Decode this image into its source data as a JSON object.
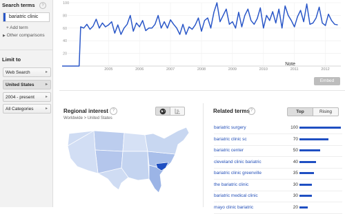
{
  "sidebar": {
    "search_terms_heading": "Search terms",
    "help_icon": "?",
    "term": "bariatric clinic",
    "add_term": "+ Add term",
    "other_comparisons": "Other comparisons",
    "limit_heading": "Limit to",
    "filters": [
      {
        "label": "Web Search",
        "selected": false
      },
      {
        "label": "United States",
        "selected": true
      },
      {
        "label": "2004 - present",
        "selected": false
      },
      {
        "label": "All Categories",
        "selected": false
      }
    ]
  },
  "chart_data": {
    "type": "line",
    "x_ticks": [
      "2005",
      "2006",
      "2007",
      "2008",
      "2009",
      "2010",
      "2011",
      "2012"
    ],
    "y_ticks": [
      "100",
      "80",
      "60",
      "40",
      "20"
    ],
    "ylim": [
      0,
      100
    ],
    "annotation": "Note",
    "color": "#2a57c8",
    "x": [
      2004.0,
      2004.3,
      2004.55,
      2004.6,
      2004.7,
      2004.8,
      2004.9,
      2005.0,
      2005.1,
      2005.2,
      2005.3,
      2005.4,
      2005.5,
      2005.6,
      2005.7,
      2005.8,
      2005.9,
      2006.0,
      2006.1,
      2006.2,
      2006.3,
      2006.4,
      2006.5,
      2006.6,
      2006.7,
      2006.8,
      2006.9,
      2007.0,
      2007.1,
      2007.2,
      2007.3,
      2007.4,
      2007.5,
      2007.6,
      2007.7,
      2007.8,
      2007.9,
      2008.0,
      2008.1,
      2008.2,
      2008.3,
      2008.4,
      2008.5,
      2008.6,
      2008.7,
      2008.8,
      2008.9,
      2009.0,
      2009.1,
      2009.2,
      2009.3,
      2009.4,
      2009.5,
      2009.6,
      2009.7,
      2009.8,
      2009.9,
      2010.0,
      2010.1,
      2010.2,
      2010.3,
      2010.4,
      2010.5,
      2010.6,
      2010.7,
      2010.8,
      2010.9,
      2011.0,
      2011.1,
      2011.2,
      2011.3,
      2011.4,
      2011.5,
      2011.6,
      2011.7,
      2011.8,
      2011.9,
      2012.0,
      2012.1,
      2012.2,
      2012.3,
      2012.4,
      2012.5,
      2012.6,
      2012.7,
      2012.8,
      2012.9
    ],
    "values": [
      0,
      0,
      0,
      62,
      60,
      66,
      58,
      63,
      74,
      60,
      68,
      62,
      65,
      70,
      52,
      65,
      50,
      60,
      66,
      80,
      55,
      68,
      62,
      72,
      56,
      60,
      60,
      66,
      80,
      60,
      70,
      60,
      73,
      66,
      60,
      50,
      66,
      50,
      62,
      58,
      65,
      76,
      55,
      72,
      76,
      60,
      85,
      100,
      70,
      80,
      90,
      66,
      70,
      60,
      85,
      62,
      80,
      90,
      72,
      66,
      75,
      92,
      60,
      80,
      72,
      86,
      68,
      90,
      60,
      95,
      80,
      72,
      62,
      78,
      88,
      70,
      98,
      66,
      68,
      76,
      93,
      68,
      64,
      82,
      72,
      66,
      65
    ]
  },
  "embed": "Embed",
  "regional": {
    "title": "Regional interest",
    "help_icon": "?",
    "breadcrumb": "Worldwide > United States",
    "map_icon": "globe-icon",
    "list_icon": "list-icon",
    "highlight_color": "#1f4fc2"
  },
  "related": {
    "title": "Related terms",
    "help_icon": "?",
    "tabs": [
      {
        "label": "Top",
        "active": true
      },
      {
        "label": "Rising",
        "active": false
      }
    ],
    "rows": [
      {
        "term": "bariatric surgery",
        "value": 100
      },
      {
        "term": "bariatric clinic sc",
        "value": 70
      },
      {
        "term": "bariatric center",
        "value": 50
      },
      {
        "term": "cleveland clinic bariatric",
        "value": 40
      },
      {
        "term": "bariatric clinic greenville",
        "value": 35
      },
      {
        "term": "the bariatric clinic",
        "value": 30
      },
      {
        "term": "bariatric medical clinic",
        "value": 30
      },
      {
        "term": "mayo clinic bariatric",
        "value": 20
      }
    ]
  }
}
